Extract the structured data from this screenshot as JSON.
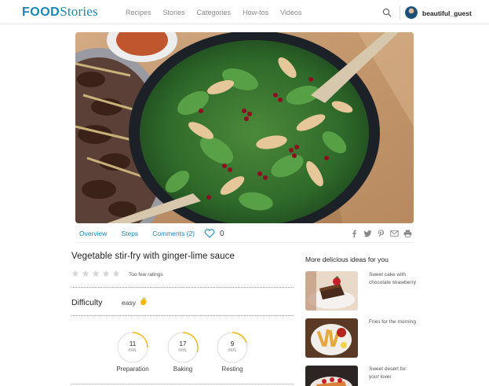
{
  "header": {
    "logo_part1": "FOOD",
    "logo_part2": "Stories",
    "nav": [
      "Recipes",
      "Stories",
      "Categories",
      "How-tos",
      "Videos"
    ],
    "username": "beautiful_guest"
  },
  "tabs": {
    "overview": "Overview",
    "steps": "Steps",
    "comments": "Comments (2)",
    "likes": "0"
  },
  "recipe": {
    "title": "Vegetable stir-fry with ginger-lime sauce",
    "ratings_text": "Too few ratings",
    "difficulty_label": "Difficulty",
    "difficulty_value": "easy",
    "timers": [
      {
        "value": "11",
        "unit": "min.",
        "label": "Preparation",
        "progress": 0.25
      },
      {
        "value": "17",
        "unit": "min.",
        "label": "Baking",
        "progress": 0.3
      },
      {
        "value": "9",
        "unit": "min.",
        "label": "Resting",
        "progress": 0.2
      }
    ]
  },
  "sidebar": {
    "title": "More delicious ideas for you",
    "ideas": [
      {
        "text": "Sweet cake with chocolate strawberry"
      },
      {
        "text": "Fries for the morning"
      },
      {
        "text": "Sweet desert for your lover"
      }
    ]
  },
  "colors": {
    "accent": "#1a86b6",
    "timer_ring": "#f2b705"
  },
  "icons": {
    "share": [
      "facebook-icon",
      "twitter-icon",
      "pinterest-icon",
      "mail-icon",
      "print-icon"
    ]
  }
}
